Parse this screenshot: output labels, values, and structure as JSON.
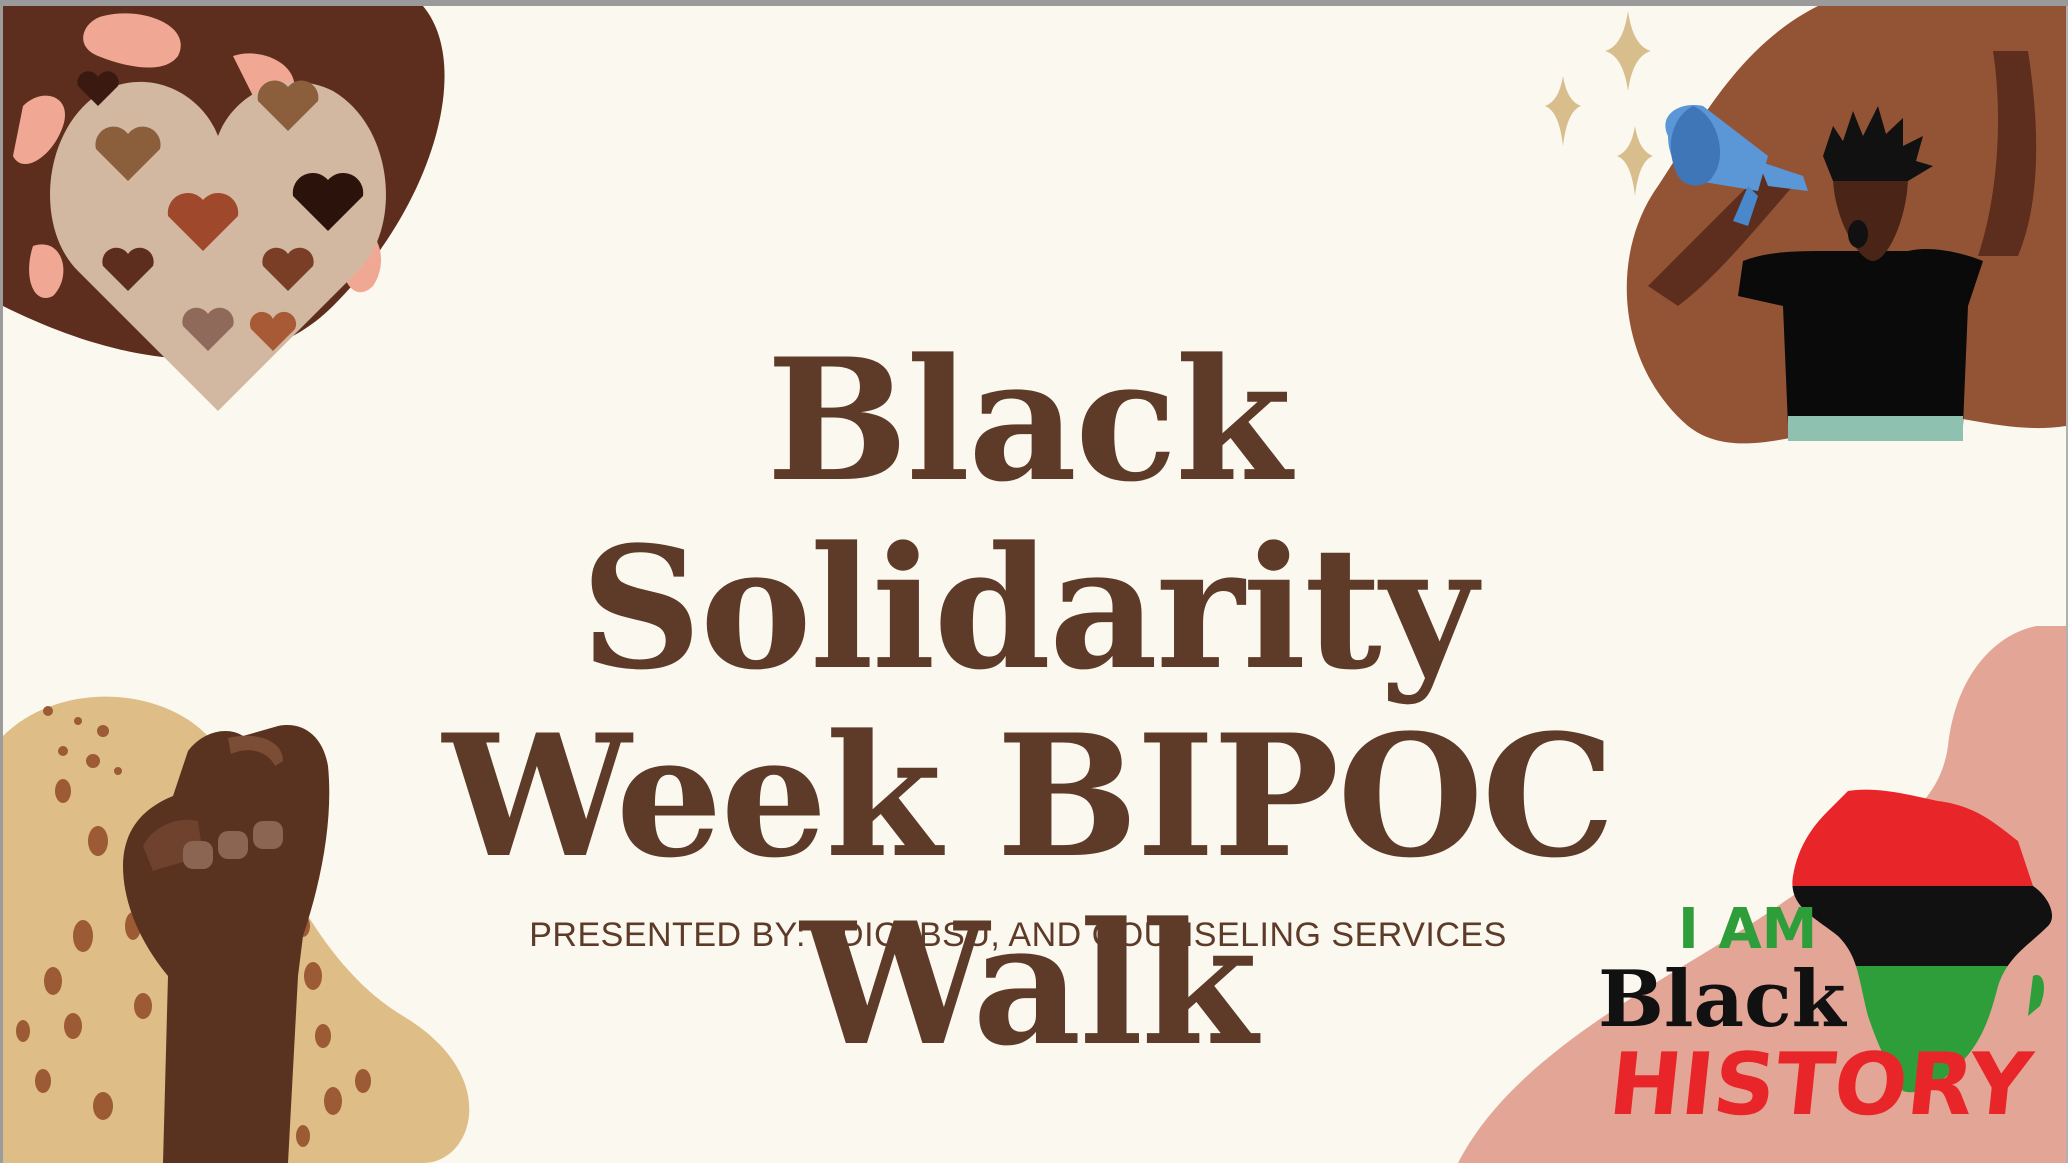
{
  "slide": {
    "title_lines": [
      "Black Solidarity",
      "Week BIPOC",
      "Walk"
    ],
    "subtitle": "PRESENTED BY: EDIC, BSU, AND COUNSELING SERVICES"
  },
  "badge": {
    "line1": "I AM",
    "line2": "Black",
    "line3": "HISTORY"
  },
  "colors": {
    "background": "#FBF8EF",
    "title": "#5E3B29",
    "flag_red": "#E8262A",
    "flag_black": "#111111",
    "flag_green": "#2E9E3A"
  },
  "icons": [
    "heart-pattern-icon",
    "sparkle-icon",
    "megaphone-person-icon",
    "raised-fist-icon",
    "africa-map-icon"
  ]
}
